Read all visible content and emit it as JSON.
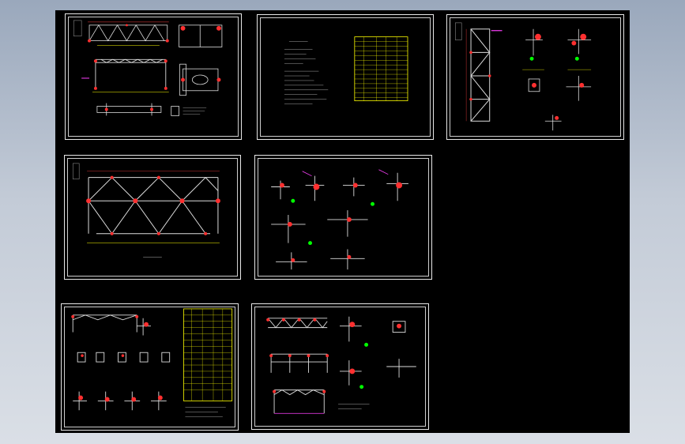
{
  "viewer": {
    "background_color": "#000000",
    "border_color": "#e8e8e8"
  },
  "sheets": [
    {
      "id": "sheet-1",
      "icon": "steel-frame-elevation-drawing"
    },
    {
      "id": "sheet-2",
      "icon": "design-notes-and-material-table"
    },
    {
      "id": "sheet-3",
      "icon": "column-elevation-and-node-details"
    },
    {
      "id": "sheet-4",
      "icon": "truss-elevation-drawing"
    },
    {
      "id": "sheet-5",
      "icon": "joint-connection-details"
    },
    {
      "id": "sheet-6",
      "icon": "truss-details-and-schedule"
    },
    {
      "id": "sheet-7",
      "icon": "frame-elevations-and-connections"
    }
  ]
}
